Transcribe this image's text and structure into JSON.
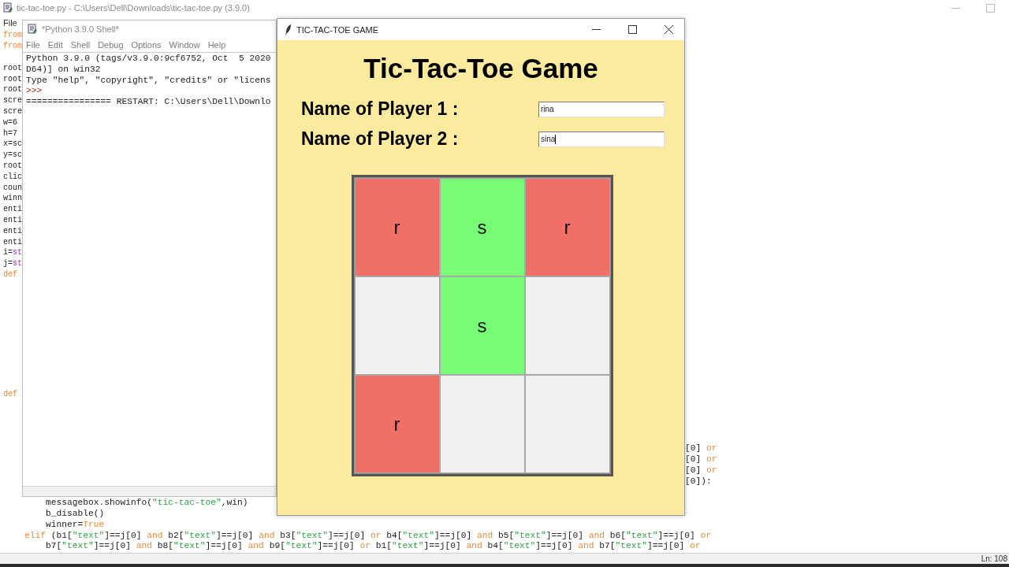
{
  "editor": {
    "title": "tic-tac-toe.py - C:\\Users\\Dell\\Downloads\\tic-tac-toe.py (3.9.0)",
    "menu": [
      "File"
    ],
    "rows": [
      {
        "left": [
          {
            "kind": "keyword",
            "text": "from"
          }
        ]
      },
      {
        "left": [
          {
            "kind": "keyword",
            "text": "from"
          }
        ]
      },
      {},
      {
        "left": [
          {
            "kind": "plain",
            "text": "root"
          }
        ]
      },
      {
        "left": [
          {
            "kind": "plain",
            "text": "root"
          }
        ]
      },
      {
        "left": [
          {
            "kind": "plain",
            "text": "root"
          }
        ]
      },
      {
        "left": [
          {
            "kind": "plain",
            "text": "scre"
          }
        ]
      },
      {
        "left": [
          {
            "kind": "plain",
            "text": "scre"
          }
        ]
      },
      {
        "left": [
          {
            "kind": "plain",
            "text": "w=6"
          }
        ]
      },
      {
        "left": [
          {
            "kind": "plain",
            "text": "h=7"
          }
        ]
      },
      {
        "left": [
          {
            "kind": "plain",
            "text": "x=sc"
          }
        ]
      },
      {
        "left": [
          {
            "kind": "plain",
            "text": "y=sc"
          }
        ]
      },
      {
        "left": [
          {
            "kind": "plain",
            "text": "root"
          }
        ]
      },
      {
        "left": [
          {
            "kind": "plain",
            "text": "clic"
          }
        ]
      },
      {
        "left": [
          {
            "kind": "plain",
            "text": "coun"
          }
        ]
      },
      {
        "left": [
          {
            "kind": "plain",
            "text": "winn"
          }
        ]
      },
      {
        "left": [
          {
            "kind": "plain",
            "text": "enti"
          }
        ]
      },
      {
        "left": [
          {
            "kind": "plain",
            "text": "enti"
          }
        ]
      },
      {
        "left": [
          {
            "kind": "plain",
            "text": "enti"
          }
        ]
      },
      {
        "left": [
          {
            "kind": "plain",
            "text": "enti"
          }
        ]
      },
      {
        "left": [
          {
            "kind": "plain",
            "text": "i="
          },
          {
            "kind": "builtin",
            "text": "st"
          }
        ]
      },
      {
        "left": [
          {
            "kind": "plain",
            "text": "j="
          },
          {
            "kind": "builtin",
            "text": "st"
          }
        ]
      },
      {
        "left": [
          {
            "kind": "keyword",
            "text": "def"
          }
        ]
      },
      {},
      {},
      {},
      {},
      {},
      {},
      {},
      {},
      {},
      {},
      {
        "left": [
          {
            "kind": "keyword",
            "text": "def"
          }
        ]
      },
      {},
      {},
      {},
      {},
      {
        "right": [
          {
            "kind": "plain",
            "text": "[0] "
          },
          {
            "kind": "keyword",
            "text": "or"
          }
        ]
      },
      {
        "right": [
          {
            "kind": "plain",
            "text": "[0] "
          },
          {
            "kind": "keyword",
            "text": "or"
          }
        ]
      },
      {
        "right": [
          {
            "kind": "plain",
            "text": "[0] "
          },
          {
            "kind": "keyword",
            "text": "or"
          }
        ]
      },
      {
        "right": [
          {
            "kind": "plain",
            "text": "[0]):"
          }
        ]
      },
      {},
      {
        "code": [
          {
            "kind": "plain",
            "text": "    messagebox.showinfo("
          },
          {
            "kind": "string",
            "text": "\"tic-tac-toe\""
          },
          {
            "kind": "plain",
            "text": ",win)"
          }
        ]
      },
      {
        "code": [
          {
            "kind": "plain",
            "text": "    b_disable()"
          }
        ]
      },
      {
        "code": [
          {
            "kind": "plain",
            "text": "    winner="
          },
          {
            "kind": "keyword",
            "text": "True"
          }
        ]
      },
      {
        "code": [
          {
            "kind": "keyword",
            "text": "elif"
          },
          {
            "kind": "plain",
            "text": " (b1["
          },
          {
            "kind": "string",
            "text": "\"text\""
          },
          {
            "kind": "plain",
            "text": "]==j[0] "
          },
          {
            "kind": "keyword",
            "text": "and"
          },
          {
            "kind": "plain",
            "text": " b2["
          },
          {
            "kind": "string",
            "text": "\"text\""
          },
          {
            "kind": "plain",
            "text": "]==j[0] "
          },
          {
            "kind": "keyword",
            "text": "and"
          },
          {
            "kind": "plain",
            "text": " b3["
          },
          {
            "kind": "string",
            "text": "\"text\""
          },
          {
            "kind": "plain",
            "text": "]==j[0] "
          },
          {
            "kind": "keyword",
            "text": "or"
          },
          {
            "kind": "plain",
            "text": " b4["
          },
          {
            "kind": "string",
            "text": "\"text\""
          },
          {
            "kind": "plain",
            "text": "]==j[0] "
          },
          {
            "kind": "keyword",
            "text": "and"
          },
          {
            "kind": "plain",
            "text": " b5["
          },
          {
            "kind": "string",
            "text": "\"text\""
          },
          {
            "kind": "plain",
            "text": "]==j[0] "
          },
          {
            "kind": "keyword",
            "text": "and"
          },
          {
            "kind": "plain",
            "text": " b6["
          },
          {
            "kind": "string",
            "text": "\"text\""
          },
          {
            "kind": "plain",
            "text": "]==j[0] "
          },
          {
            "kind": "keyword",
            "text": "or"
          }
        ]
      },
      {
        "code": [
          {
            "kind": "plain",
            "text": "    b7["
          },
          {
            "kind": "string",
            "text": "\"text\""
          },
          {
            "kind": "plain",
            "text": "]==j[0] "
          },
          {
            "kind": "keyword",
            "text": "and"
          },
          {
            "kind": "plain",
            "text": " b8["
          },
          {
            "kind": "string",
            "text": "\"text\""
          },
          {
            "kind": "plain",
            "text": "]==j[0] "
          },
          {
            "kind": "keyword",
            "text": "and"
          },
          {
            "kind": "plain",
            "text": " b9["
          },
          {
            "kind": "string",
            "text": "\"text\""
          },
          {
            "kind": "plain",
            "text": "]==j[0] "
          },
          {
            "kind": "keyword",
            "text": "or"
          },
          {
            "kind": "plain",
            "text": " b1["
          },
          {
            "kind": "string",
            "text": "\"text\""
          },
          {
            "kind": "plain",
            "text": "]==j[0] "
          },
          {
            "kind": "keyword",
            "text": "and"
          },
          {
            "kind": "plain",
            "text": " b4["
          },
          {
            "kind": "string",
            "text": "\"text\""
          },
          {
            "kind": "plain",
            "text": "]==j[0] "
          },
          {
            "kind": "keyword",
            "text": "and"
          },
          {
            "kind": "plain",
            "text": " b7["
          },
          {
            "kind": "string",
            "text": "\"text\""
          },
          {
            "kind": "plain",
            "text": "]==j[0] "
          },
          {
            "kind": "keyword",
            "text": "or"
          }
        ]
      }
    ],
    "status": "Ln: 108"
  },
  "shell": {
    "title": "*Python 3.9.0 Shell*",
    "menu": [
      "File",
      "Edit",
      "Shell",
      "Debug",
      "Options",
      "Window",
      "Help"
    ],
    "lines": [
      [
        {
          "kind": "plain",
          "text": "Python 3.9.0 (tags/v3.9.0:9cf6752, Oct  5 2020"
        }
      ],
      [
        {
          "kind": "plain",
          "text": "D64)] on win32"
        }
      ],
      [
        {
          "kind": "plain",
          "text": "Type \"help\", \"copyright\", \"credits\" or \"licens"
        }
      ],
      [
        {
          "kind": "prompt",
          "text": ">>>"
        }
      ],
      [
        {
          "kind": "plain",
          "text": "================ RESTART: C:\\Users\\Dell\\Downlo"
        }
      ]
    ]
  },
  "game": {
    "title": "TIC-TAC-TOE GAME",
    "heading": "Tic-Tac-Toe Game",
    "players": [
      {
        "label": "Name of Player 1 :",
        "value": "rina",
        "focused": false
      },
      {
        "label": "Name of Player 2 :",
        "value": "sina",
        "focused": true
      }
    ],
    "board": {
      "cells": [
        {
          "text": "r",
          "color": "#f07068"
        },
        {
          "text": "s",
          "color": "#78fc78"
        },
        {
          "text": "r",
          "color": "#f07068"
        },
        {
          "color": "#f0f0f0"
        },
        {
          "text": "s",
          "color": "#78fc78"
        },
        {
          "color": "#f0f0f0"
        },
        {
          "text": "r",
          "color": "#f07068"
        },
        {
          "color": "#f0f0f0"
        },
        {
          "color": "#f0f0f0"
        }
      ]
    }
  }
}
